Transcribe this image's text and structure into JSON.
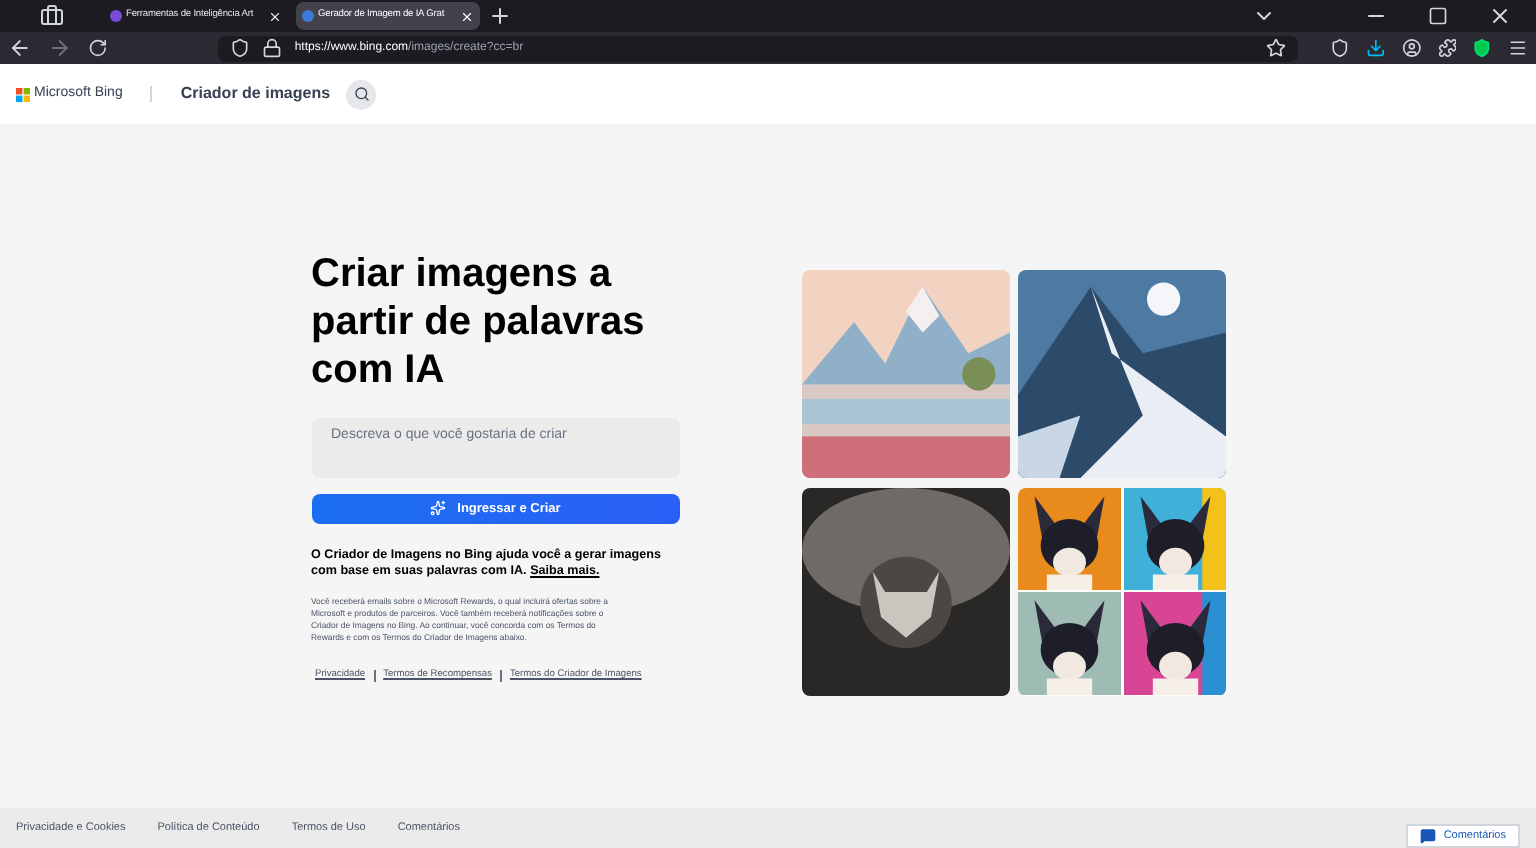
{
  "browser": {
    "tabs": [
      {
        "title": "Ferramentas de Inteligência Art",
        "selected": false
      },
      {
        "title": "Gerador de Imagem de IA Grat",
        "selected": true
      }
    ],
    "url": {
      "host": "https://www.bing.com",
      "path": "/images/create?cc=br"
    }
  },
  "header": {
    "brand": "Microsoft Bing",
    "section": "Criador de imagens"
  },
  "hero": {
    "title": "Criar imagens a partir de palavras com IA",
    "prompt": {
      "placeholder": "Descreva o que você gostaria de criar"
    },
    "button": "Ingressar e Criar",
    "description": "O Criador de Imagens no Bing ajuda você a gerar imagens com base em suas palavras com IA.",
    "learn_more": "Saiba mais.",
    "fine_print": "Você receberá emails sobre o Microsoft Rewards, o qual incluirá ofertas sobre a Microsoft e produtos de parceiros. Você também receberá notificações sobre o Criador de Imagens no Bing. Ao continuar, você concorda com os Termos do Rewards e com os Termos do Criador de Imagens abaixo.",
    "links": [
      "Privacidade",
      "Termos de Recompensas",
      "Termos do Criador de Imagens"
    ]
  },
  "footer": {
    "links": [
      "Privacidade e Cookies",
      "Política de Conteúdo",
      "Termos de Uso",
      "Comentários"
    ],
    "feedback": "Comentários"
  }
}
